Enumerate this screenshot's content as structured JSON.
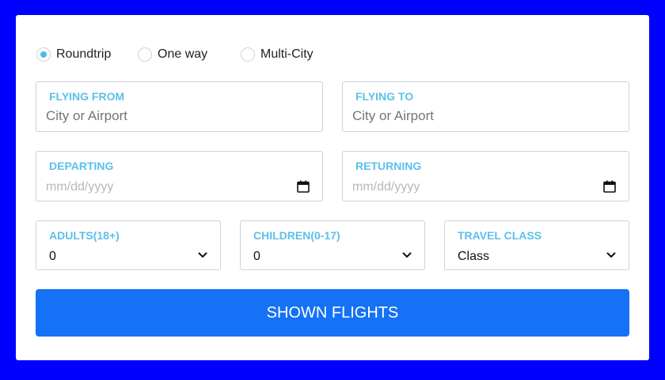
{
  "trip_types": [
    {
      "label": "Roundtrip",
      "selected": true
    },
    {
      "label": "One way",
      "selected": false
    },
    {
      "label": "Multi-City",
      "selected": false
    }
  ],
  "flying_from": {
    "label": "FLYING FROM",
    "placeholder": "City or Airport",
    "value": ""
  },
  "flying_to": {
    "label": "FLYING TO",
    "placeholder": "City or Airport",
    "value": ""
  },
  "departing": {
    "label": "DEPARTING",
    "placeholder": "mm/dd/yyyy",
    "icon": "calendar-icon"
  },
  "returning": {
    "label": "RETURNING",
    "placeholder": "mm/dd/yyyy",
    "icon": "calendar-icon"
  },
  "adults": {
    "label": "ADULTS(18+)",
    "selected": "0",
    "icon": "chevron-down-icon"
  },
  "children": {
    "label": "CHILDREN(0-17)",
    "selected": "0",
    "icon": "chevron-down-icon"
  },
  "travel_class": {
    "label": "TRAVEL CLASS",
    "selected": "Class",
    "icon": "chevron-down-icon"
  },
  "submit_label": "SHOWN FLIGHTS",
  "colors": {
    "page_background": "#0000ff",
    "card_background": "#ffffff",
    "label_accent": "#5cc0ea",
    "radio_accent": "#4dbbea",
    "button_background": "#1571f6",
    "button_text": "#ffffff",
    "placeholder_text": "#b4b9bf",
    "field_border": "#cdd2d8"
  }
}
